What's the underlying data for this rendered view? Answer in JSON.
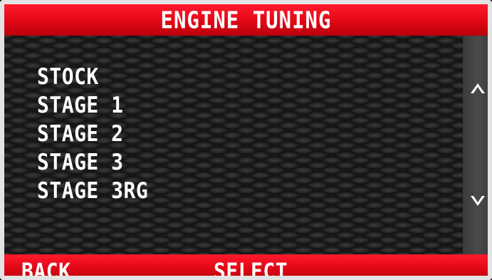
{
  "header": {
    "title": "ENGINE TUNING"
  },
  "menu": {
    "items": [
      {
        "label": "STOCK"
      },
      {
        "label": "STAGE 1"
      },
      {
        "label": "STAGE 2"
      },
      {
        "label": "STAGE 3"
      },
      {
        "label": "STAGE 3RG"
      }
    ]
  },
  "scrollbar": {
    "up_icon": "chevron-up-icon",
    "down_icon": "chevron-down-icon",
    "up_glyph": "⌃",
    "down_glyph": "⌄"
  },
  "footer": {
    "back_label": "BACK",
    "select_label": "SELECT"
  },
  "colors": {
    "accent": "#e10816",
    "text": "#ffffff",
    "scrollbar": "#444444"
  }
}
